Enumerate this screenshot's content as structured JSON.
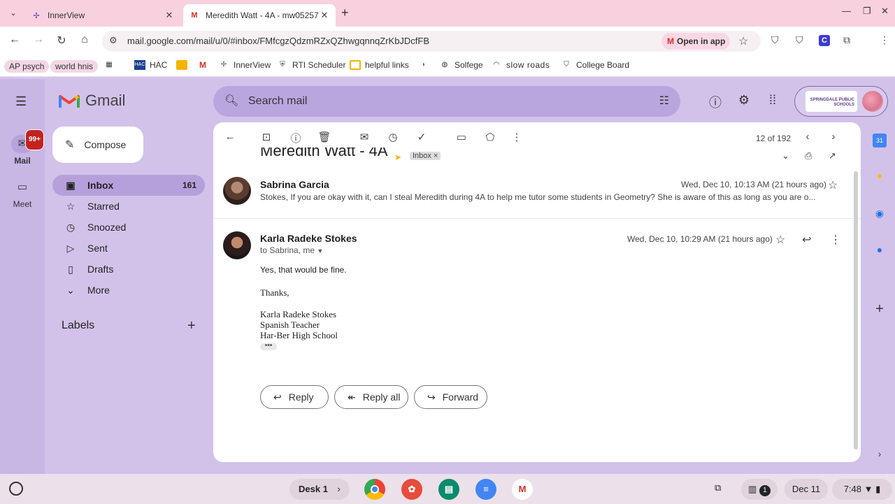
{
  "browser": {
    "tabs": [
      {
        "title": "InnerView",
        "active": false
      },
      {
        "title": "Meredith Watt - 4A - mw05257",
        "active": true
      }
    ],
    "url": "mail.google.com/mail/u/0/#inbox/FMfcgzQdzmRZxQZhwgqnnqZrKbJDcfFB",
    "open_in_app": "Open in app",
    "bookmarks": [
      "AP psych",
      "world hnis",
      "HAC",
      "InnerView",
      "RTI Scheduler",
      "helpful links",
      "Solfege",
      "slow roads",
      "College Board"
    ]
  },
  "gmail": {
    "brand": "Gmail",
    "rail": {
      "mail_label": "Mail",
      "mail_badge": "99+",
      "meet_label": "Meet"
    },
    "compose_label": "Compose",
    "nav": [
      {
        "label": "Inbox",
        "count": "161"
      },
      {
        "label": "Starred"
      },
      {
        "label": "Snoozed"
      },
      {
        "label": "Sent"
      },
      {
        "label": "Drafts"
      },
      {
        "label": "More"
      }
    ],
    "labels_heading": "Labels",
    "search_placeholder": "Search mail",
    "account_school": "SPRINGDALE PUBLIC SCHOOLS"
  },
  "thread": {
    "pager": "12 of 192",
    "subject": "Meredith Watt - 4A",
    "inbox_chip": "Inbox",
    "messages": [
      {
        "sender": "Sabrina Garcia",
        "date": "Wed, Dec 10, 10:13 AM (21 hours ago)",
        "snippet": "Stokes, If you are okay with it, can I steal Meredith during 4A to help me tutor some students in Geometry? She is aware of this as long as you are o..."
      },
      {
        "sender": "Karla Radeke Stokes",
        "to": "to Sabrina, me",
        "date": "Wed, Dec 10, 10:29 AM (21 hours ago)",
        "body": [
          "Yes, that would be fine.",
          "Thanks,"
        ],
        "signature": [
          "Karla Radeke Stokes",
          "Spanish Teacher",
          "Har-Ber High School"
        ]
      }
    ],
    "actions": {
      "reply": "Reply",
      "reply_all": "Reply all",
      "forward": "Forward"
    }
  },
  "shelf": {
    "desk": "Desk 1",
    "notif_count": "1",
    "date": "Dec 11",
    "time": "7:48"
  },
  "colors": {
    "gmail_bg": "#d2c2ea",
    "active_nav": "#b6a0db",
    "tab_strip": "#f8d0de",
    "badge_red": "#c5221f"
  }
}
